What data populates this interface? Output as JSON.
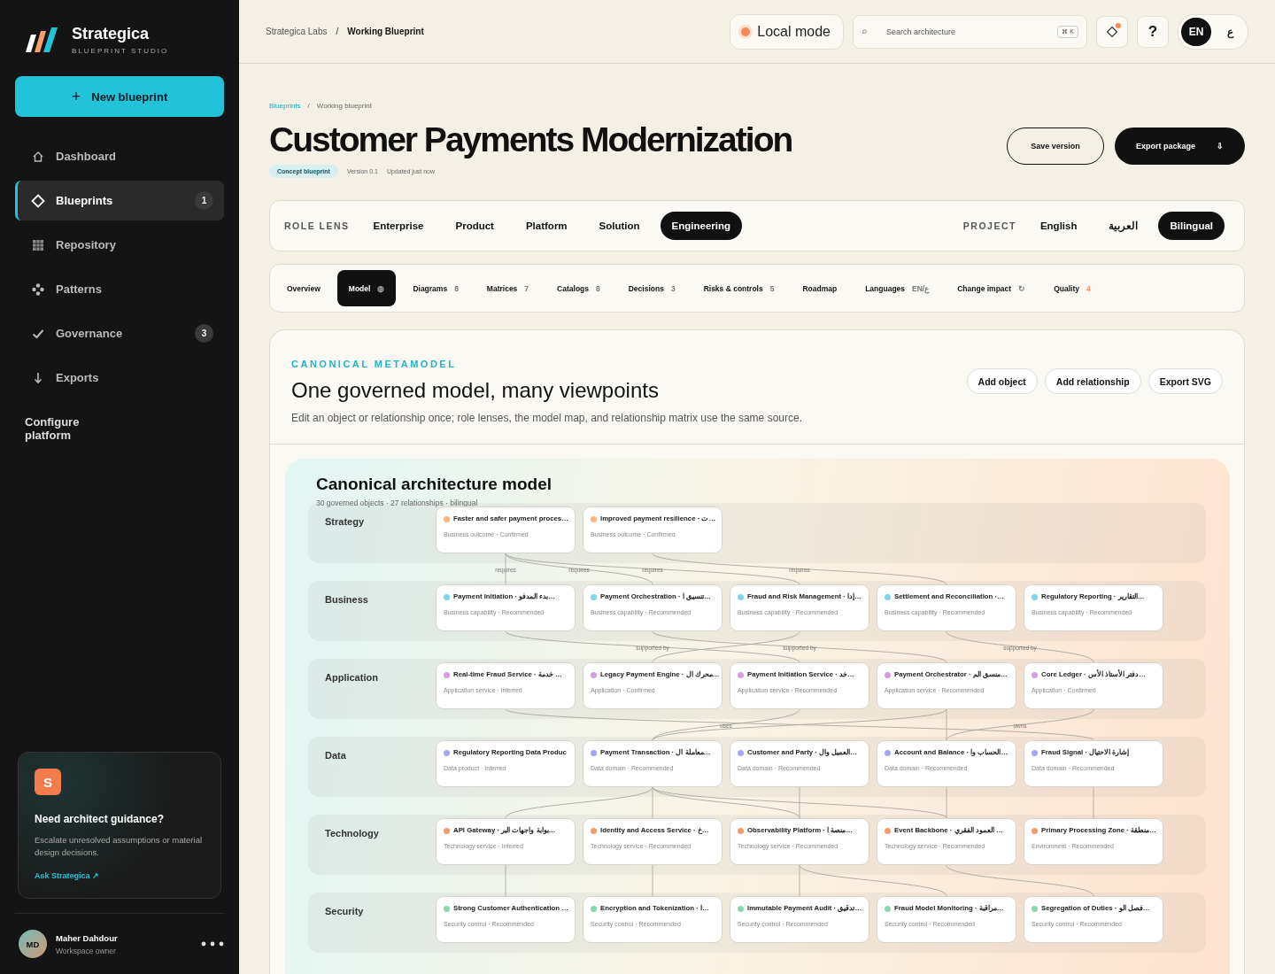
{
  "brand": {
    "name": "Strategica",
    "tagline": "BLUEPRINT STUDIO"
  },
  "new_button": {
    "icon": "+",
    "label": "New blueprint"
  },
  "nav": [
    {
      "label": "Dashboard",
      "selected": false
    },
    {
      "label": "Blueprints",
      "selected": true,
      "badge": "1"
    },
    {
      "label": "Repository",
      "selected": false
    },
    {
      "label": "Patterns",
      "selected": false
    },
    {
      "label": "Governance",
      "selected": false,
      "badge": "3"
    },
    {
      "label": "Exports",
      "selected": false
    }
  ],
  "configure_link": "Configure platform",
  "guidance": {
    "avatar": "S",
    "title": "Need architect guidance?",
    "text": "Escalate unresolved assumptions or material design decisions.",
    "link": "Ask Strategica ↗"
  },
  "user": {
    "initials": "MD",
    "name": "Maher Dahdour",
    "role": "Workspace owner"
  },
  "topbar": {
    "breadcrumb": [
      "Strategica Labs",
      "Working Blueprint"
    ],
    "separator": "/",
    "mode": "Local mode",
    "search_placeholder": "Search architecture",
    "shortcut": "⌘ K",
    "help": "?",
    "languages": [
      {
        "label": "EN",
        "selected": true
      },
      {
        "label": "ع",
        "selected": false
      }
    ]
  },
  "page": {
    "breadcrumb": [
      "Blueprints",
      "Working blueprint"
    ],
    "separator": "/",
    "title": "Customer Payments Modernization",
    "tag": "Concept blueprint",
    "version": "Version 0.1",
    "updated": "Updated just now",
    "save": "Save version",
    "export": "Export package",
    "export_icon": "⇩"
  },
  "role_lens": {
    "label": "ROLE LENS",
    "items": [
      {
        "label": "Enterprise",
        "selected": false
      },
      {
        "label": "Product",
        "selected": false
      },
      {
        "label": "Platform",
        "selected": false
      },
      {
        "label": "Solution",
        "selected": false
      },
      {
        "label": "Engineering",
        "selected": true
      }
    ]
  },
  "project": {
    "label": "PROJECT",
    "items": [
      {
        "label": "English",
        "selected": false
      },
      {
        "label": "العربية",
        "selected": false
      },
      {
        "label": "Bilingual",
        "selected": true
      }
    ]
  },
  "tabs": [
    {
      "label": "Overview",
      "selected": false
    },
    {
      "label": "Model",
      "count": "◍",
      "selected": true
    },
    {
      "label": "Diagrams",
      "count": "8",
      "selected": false
    },
    {
      "label": "Matrices",
      "count": "7",
      "selected": false
    },
    {
      "label": "Catalogs",
      "count": "8",
      "selected": false
    },
    {
      "label": "Decisions",
      "count": "3",
      "selected": false
    },
    {
      "label": "Risks & controls",
      "count": "5",
      "selected": false
    },
    {
      "label": "Roadmap",
      "selected": false
    },
    {
      "label": "Languages",
      "count": "EN/ع",
      "selected": false
    },
    {
      "label": "Change impact",
      "count": "↻",
      "selected": false
    },
    {
      "label": "Quality",
      "count": "4",
      "selected": false,
      "alert": true
    }
  ],
  "section": {
    "eyebrow": "CANONICAL METAMODEL",
    "title": "One governed model, many viewpoints",
    "text": "Edit an object or relationship once; role lenses, the model map, and relationship matrix use the same source.",
    "actions": [
      "Add object",
      "Add relationship",
      "Export SVG"
    ]
  },
  "model": {
    "title": "Canonical architecture model",
    "subtitle": "30 governed objects · 27 relationships · bilingual",
    "layers": [
      {
        "name": "Strategy",
        "color": "#fbb57f",
        "nodes": [
          {
            "title": "Faster and safer payment proces…",
            "meta": "Business outcome · Confirmed"
          },
          {
            "title": "Improved payment resilience · ت…",
            "meta": "Business outcome · Confirmed"
          }
        ]
      },
      {
        "name": "Business",
        "color": "#7ad9e8",
        "nodes": [
          {
            "title": "Payment Initiation · بدء المدفو…",
            "meta": "Business capability · Recommended"
          },
          {
            "title": "Payment Orchestration · تنسيق ا…",
            "meta": "Business capability · Recommended"
          },
          {
            "title": "Fraud and Risk Management · إدا…",
            "meta": "Business capability · Recommended"
          },
          {
            "title": "Settlement and Reconciliation ·…",
            "meta": "Business capability · Recommended"
          },
          {
            "title": "Regulatory Reporting · التقارير…",
            "meta": "Business capability · Recommended"
          }
        ]
      },
      {
        "name": "Application",
        "color": "#d39de0",
        "nodes": [
          {
            "title": "Real-time Fraud Service · خدمة …",
            "meta": "Application service · Inferred"
          },
          {
            "title": "Legacy Payment Engine · محرك ال…",
            "meta": "Application · Confirmed"
          },
          {
            "title": "Payment Initiation Service · خد…",
            "meta": "Application service · Recommended"
          },
          {
            "title": "Payment Orchestrator · منسق الم…",
            "meta": "Application service · Recommended"
          },
          {
            "title": "Core Ledger · دفتر الأستاذ الأس…",
            "meta": "Application · Confirmed"
          }
        ]
      },
      {
        "name": "Data",
        "color": "#a2a8f0",
        "nodes": [
          {
            "title": "Regulatory Reporting Data Produc",
            "meta": "Data product · Inferred"
          },
          {
            "title": "Payment Transaction · معاملة ال…",
            "meta": "Data domain · Recommended"
          },
          {
            "title": "Customer and Party · العميل وال…",
            "meta": "Data domain · Recommended"
          },
          {
            "title": "Account and Balance · الحساب وا…",
            "meta": "Data domain · Recommended"
          },
          {
            "title": "Fraud Signal · إشارة الاحتيال",
            "meta": "Data domain · Recommended"
          }
        ]
      },
      {
        "name": "Technology",
        "color": "#f59a6c",
        "nodes": [
          {
            "title": "API Gateway · بوابة واجهات البر…",
            "meta": "Technology service · Inferred"
          },
          {
            "title": "Identity and Access Service · خ…",
            "meta": "Technology service · Recommended"
          },
          {
            "title": "Observability Platform · منصة ا…",
            "meta": "Technology service · Recommended"
          },
          {
            "title": "Event Backbone · العمود الفقري …",
            "meta": "Technology service · Recommended"
          },
          {
            "title": "Primary Processing Zone · منطقة…",
            "meta": "Environment · Recommended"
          }
        ]
      },
      {
        "name": "Security",
        "color": "#8ad7a9",
        "nodes": [
          {
            "title": "Strong Customer Authentication …",
            "meta": "Security control · Recommended"
          },
          {
            "title": "Encryption and Tokenization · ا…",
            "meta": "Security control · Recommended"
          },
          {
            "title": "Immutable Payment Audit · تدقيق…",
            "meta": "Security control · Recommended"
          },
          {
            "title": "Fraud Model Monitoring · مراقبة…",
            "meta": "Security control · Recommended"
          },
          {
            "title": "Segregation of Duties · فصل الو…",
            "meta": "Security control · Recommended"
          }
        ]
      }
    ],
    "edge_labels": [
      "requires",
      "requires",
      "requires",
      "requires",
      "supported by",
      "supported by",
      "supported by",
      "uses",
      "owns"
    ]
  }
}
